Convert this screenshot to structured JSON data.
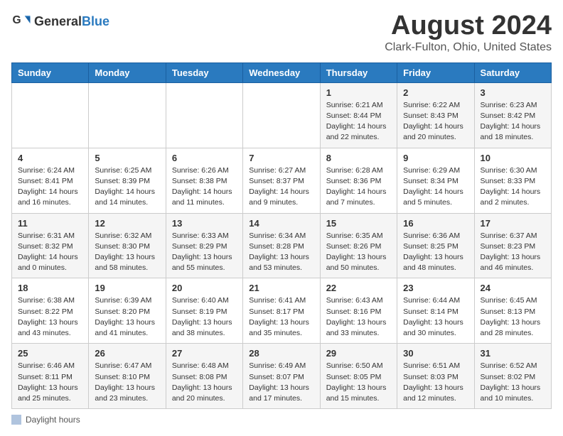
{
  "header": {
    "logo_general": "General",
    "logo_blue": "Blue",
    "title": "August 2024",
    "location": "Clark-Fulton, Ohio, United States"
  },
  "weekdays": [
    "Sunday",
    "Monday",
    "Tuesday",
    "Wednesday",
    "Thursday",
    "Friday",
    "Saturday"
  ],
  "weeks": [
    [
      {
        "day": "",
        "info": ""
      },
      {
        "day": "",
        "info": ""
      },
      {
        "day": "",
        "info": ""
      },
      {
        "day": "",
        "info": ""
      },
      {
        "day": "1",
        "info": "Sunrise: 6:21 AM\nSunset: 8:44 PM\nDaylight: 14 hours\nand 22 minutes."
      },
      {
        "day": "2",
        "info": "Sunrise: 6:22 AM\nSunset: 8:43 PM\nDaylight: 14 hours\nand 20 minutes."
      },
      {
        "day": "3",
        "info": "Sunrise: 6:23 AM\nSunset: 8:42 PM\nDaylight: 14 hours\nand 18 minutes."
      }
    ],
    [
      {
        "day": "4",
        "info": "Sunrise: 6:24 AM\nSunset: 8:41 PM\nDaylight: 14 hours\nand 16 minutes."
      },
      {
        "day": "5",
        "info": "Sunrise: 6:25 AM\nSunset: 8:39 PM\nDaylight: 14 hours\nand 14 minutes."
      },
      {
        "day": "6",
        "info": "Sunrise: 6:26 AM\nSunset: 8:38 PM\nDaylight: 14 hours\nand 11 minutes."
      },
      {
        "day": "7",
        "info": "Sunrise: 6:27 AM\nSunset: 8:37 PM\nDaylight: 14 hours\nand 9 minutes."
      },
      {
        "day": "8",
        "info": "Sunrise: 6:28 AM\nSunset: 8:36 PM\nDaylight: 14 hours\nand 7 minutes."
      },
      {
        "day": "9",
        "info": "Sunrise: 6:29 AM\nSunset: 8:34 PM\nDaylight: 14 hours\nand 5 minutes."
      },
      {
        "day": "10",
        "info": "Sunrise: 6:30 AM\nSunset: 8:33 PM\nDaylight: 14 hours\nand 2 minutes."
      }
    ],
    [
      {
        "day": "11",
        "info": "Sunrise: 6:31 AM\nSunset: 8:32 PM\nDaylight: 14 hours\nand 0 minutes."
      },
      {
        "day": "12",
        "info": "Sunrise: 6:32 AM\nSunset: 8:30 PM\nDaylight: 13 hours\nand 58 minutes."
      },
      {
        "day": "13",
        "info": "Sunrise: 6:33 AM\nSunset: 8:29 PM\nDaylight: 13 hours\nand 55 minutes."
      },
      {
        "day": "14",
        "info": "Sunrise: 6:34 AM\nSunset: 8:28 PM\nDaylight: 13 hours\nand 53 minutes."
      },
      {
        "day": "15",
        "info": "Sunrise: 6:35 AM\nSunset: 8:26 PM\nDaylight: 13 hours\nand 50 minutes."
      },
      {
        "day": "16",
        "info": "Sunrise: 6:36 AM\nSunset: 8:25 PM\nDaylight: 13 hours\nand 48 minutes."
      },
      {
        "day": "17",
        "info": "Sunrise: 6:37 AM\nSunset: 8:23 PM\nDaylight: 13 hours\nand 46 minutes."
      }
    ],
    [
      {
        "day": "18",
        "info": "Sunrise: 6:38 AM\nSunset: 8:22 PM\nDaylight: 13 hours\nand 43 minutes."
      },
      {
        "day": "19",
        "info": "Sunrise: 6:39 AM\nSunset: 8:20 PM\nDaylight: 13 hours\nand 41 minutes."
      },
      {
        "day": "20",
        "info": "Sunrise: 6:40 AM\nSunset: 8:19 PM\nDaylight: 13 hours\nand 38 minutes."
      },
      {
        "day": "21",
        "info": "Sunrise: 6:41 AM\nSunset: 8:17 PM\nDaylight: 13 hours\nand 35 minutes."
      },
      {
        "day": "22",
        "info": "Sunrise: 6:43 AM\nSunset: 8:16 PM\nDaylight: 13 hours\nand 33 minutes."
      },
      {
        "day": "23",
        "info": "Sunrise: 6:44 AM\nSunset: 8:14 PM\nDaylight: 13 hours\nand 30 minutes."
      },
      {
        "day": "24",
        "info": "Sunrise: 6:45 AM\nSunset: 8:13 PM\nDaylight: 13 hours\nand 28 minutes."
      }
    ],
    [
      {
        "day": "25",
        "info": "Sunrise: 6:46 AM\nSunset: 8:11 PM\nDaylight: 13 hours\nand 25 minutes."
      },
      {
        "day": "26",
        "info": "Sunrise: 6:47 AM\nSunset: 8:10 PM\nDaylight: 13 hours\nand 23 minutes."
      },
      {
        "day": "27",
        "info": "Sunrise: 6:48 AM\nSunset: 8:08 PM\nDaylight: 13 hours\nand 20 minutes."
      },
      {
        "day": "28",
        "info": "Sunrise: 6:49 AM\nSunset: 8:07 PM\nDaylight: 13 hours\nand 17 minutes."
      },
      {
        "day": "29",
        "info": "Sunrise: 6:50 AM\nSunset: 8:05 PM\nDaylight: 13 hours\nand 15 minutes."
      },
      {
        "day": "30",
        "info": "Sunrise: 6:51 AM\nSunset: 8:03 PM\nDaylight: 13 hours\nand 12 minutes."
      },
      {
        "day": "31",
        "info": "Sunrise: 6:52 AM\nSunset: 8:02 PM\nDaylight: 13 hours\nand 10 minutes."
      }
    ]
  ],
  "footer": {
    "label": "Daylight hours"
  }
}
